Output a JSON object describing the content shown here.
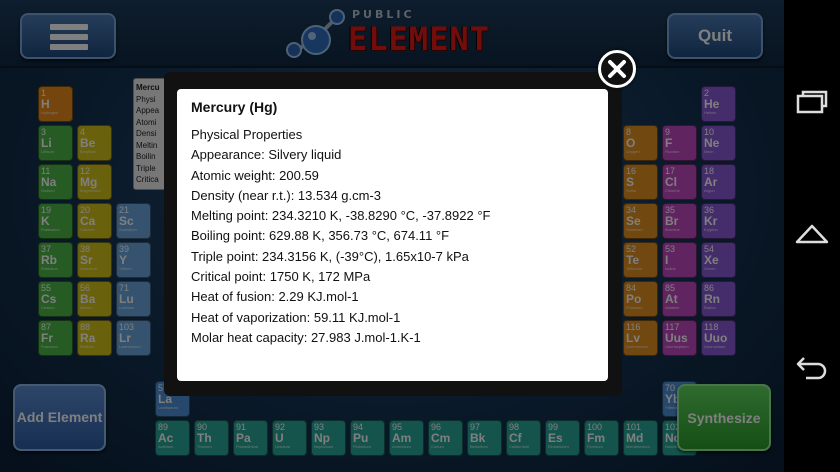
{
  "header": {
    "logo_small": "PUBLIC",
    "logo_big": "ELEMENT",
    "quit_label": "Quit"
  },
  "colors": {
    "alkali": "#4cb848",
    "alkaline": "#d4c21a",
    "transition": "#6aa6dc",
    "nonmetal": "#e09020",
    "halogen": "#c04ac0",
    "noble": "#8a5ad6",
    "lanthanide": "#4a90d9",
    "actinide": "#2aa89a",
    "hydrogen": "#e88a1a"
  },
  "elements": [
    {
      "n": "1",
      "s": "H",
      "name": "Hydrogen",
      "g": "hydrogen",
      "col": 0,
      "row": 0
    },
    {
      "n": "3",
      "s": "Li",
      "name": "Lithium",
      "g": "alkali",
      "col": 0,
      "row": 1
    },
    {
      "n": "4",
      "s": "Be",
      "name": "Beryllium",
      "g": "alkaline",
      "col": 1,
      "row": 1
    },
    {
      "n": "11",
      "s": "Na",
      "name": "Sodium",
      "g": "alkali",
      "col": 0,
      "row": 2
    },
    {
      "n": "12",
      "s": "Mg",
      "name": "Magnesium",
      "g": "alkaline",
      "col": 1,
      "row": 2
    },
    {
      "n": "19",
      "s": "K",
      "name": "Potassium",
      "g": "alkali",
      "col": 0,
      "row": 3
    },
    {
      "n": "20",
      "s": "Ca",
      "name": "Calcium",
      "g": "alkaline",
      "col": 1,
      "row": 3
    },
    {
      "n": "21",
      "s": "Sc",
      "name": "Scandium",
      "g": "transition",
      "col": 2,
      "row": 3
    },
    {
      "n": "37",
      "s": "Rb",
      "name": "Rubidium",
      "g": "alkali",
      "col": 0,
      "row": 4
    },
    {
      "n": "38",
      "s": "Sr",
      "name": "Strontium",
      "g": "alkaline",
      "col": 1,
      "row": 4
    },
    {
      "n": "39",
      "s": "Y",
      "name": "Yttrium",
      "g": "transition",
      "col": 2,
      "row": 4
    },
    {
      "n": "55",
      "s": "Cs",
      "name": "Cesium",
      "g": "alkali",
      "col": 0,
      "row": 5
    },
    {
      "n": "56",
      "s": "Ba",
      "name": "Barium",
      "g": "alkaline",
      "col": 1,
      "row": 5
    },
    {
      "n": "71",
      "s": "Lu",
      "name": "Lutetium",
      "g": "transition",
      "col": 2,
      "row": 5
    },
    {
      "n": "87",
      "s": "Fr",
      "name": "Francium",
      "g": "alkali",
      "col": 0,
      "row": 6
    },
    {
      "n": "88",
      "s": "Ra",
      "name": "Radium",
      "g": "alkaline",
      "col": 1,
      "row": 6
    },
    {
      "n": "103",
      "s": "Lr",
      "name": "Lawrencium",
      "g": "transition",
      "col": 2,
      "row": 6
    },
    {
      "n": "2",
      "s": "He",
      "name": "Helium",
      "g": "noble",
      "col": 17,
      "row": 0
    },
    {
      "n": "8",
      "s": "O",
      "name": "Oxygen",
      "g": "nonmetal",
      "col": 15,
      "row": 1
    },
    {
      "n": "9",
      "s": "F",
      "name": "Fluorine",
      "g": "halogen",
      "col": 16,
      "row": 1
    },
    {
      "n": "10",
      "s": "Ne",
      "name": "Neon",
      "g": "noble",
      "col": 17,
      "row": 1
    },
    {
      "n": "16",
      "s": "S",
      "name": "Sulfur",
      "g": "nonmetal",
      "col": 15,
      "row": 2
    },
    {
      "n": "17",
      "s": "Cl",
      "name": "Chlorine",
      "g": "halogen",
      "col": 16,
      "row": 2
    },
    {
      "n": "18",
      "s": "Ar",
      "name": "Argon",
      "g": "noble",
      "col": 17,
      "row": 2
    },
    {
      "n": "34",
      "s": "Se",
      "name": "Selenium",
      "g": "nonmetal",
      "col": 15,
      "row": 3
    },
    {
      "n": "35",
      "s": "Br",
      "name": "Bromine",
      "g": "halogen",
      "col": 16,
      "row": 3
    },
    {
      "n": "36",
      "s": "Kr",
      "name": "Krypton",
      "g": "noble",
      "col": 17,
      "row": 3
    },
    {
      "n": "52",
      "s": "Te",
      "name": "Tellurium",
      "g": "nonmetal",
      "col": 15,
      "row": 4
    },
    {
      "n": "53",
      "s": "I",
      "name": "Iodine",
      "g": "halogen",
      "col": 16,
      "row": 4
    },
    {
      "n": "54",
      "s": "Xe",
      "name": "Xenon",
      "g": "noble",
      "col": 17,
      "row": 4
    },
    {
      "n": "84",
      "s": "Po",
      "name": "Polonium",
      "g": "nonmetal",
      "col": 15,
      "row": 5
    },
    {
      "n": "85",
      "s": "At",
      "name": "Astatine",
      "g": "halogen",
      "col": 16,
      "row": 5
    },
    {
      "n": "86",
      "s": "Rn",
      "name": "Radon",
      "g": "noble",
      "col": 17,
      "row": 5
    },
    {
      "n": "116",
      "s": "Lv",
      "name": "Livermorium",
      "g": "nonmetal",
      "col": 15,
      "row": 6
    },
    {
      "n": "117",
      "s": "Uus",
      "name": "Ununseptium",
      "g": "halogen",
      "col": 16,
      "row": 6
    },
    {
      "n": "118",
      "s": "Uuo",
      "name": "Ununoctium",
      "g": "noble",
      "col": 17,
      "row": 6
    },
    {
      "n": "57",
      "s": "La",
      "name": "Lanthanum",
      "g": "lanthanide",
      "col": 3,
      "row": 8
    },
    {
      "n": "70",
      "s": "Yb",
      "name": "Ytterbium",
      "g": "lanthanide",
      "col": 16,
      "row": 8
    },
    {
      "n": "89",
      "s": "Ac",
      "name": "Actinium",
      "g": "actinide",
      "col": 3,
      "row": 9
    },
    {
      "n": "90",
      "s": "Th",
      "name": "Thorium",
      "g": "actinide",
      "col": 4,
      "row": 9
    },
    {
      "n": "91",
      "s": "Pa",
      "name": "Protactinium",
      "g": "actinide",
      "col": 5,
      "row": 9
    },
    {
      "n": "92",
      "s": "U",
      "name": "Uranium",
      "g": "actinide",
      "col": 6,
      "row": 9
    },
    {
      "n": "93",
      "s": "Np",
      "name": "Neptunium",
      "g": "actinide",
      "col": 7,
      "row": 9
    },
    {
      "n": "94",
      "s": "Pu",
      "name": "Plutonium",
      "g": "actinide",
      "col": 8,
      "row": 9
    },
    {
      "n": "95",
      "s": "Am",
      "name": "Americium",
      "g": "actinide",
      "col": 9,
      "row": 9
    },
    {
      "n": "96",
      "s": "Cm",
      "name": "Curium",
      "g": "actinide",
      "col": 10,
      "row": 9
    },
    {
      "n": "97",
      "s": "Bk",
      "name": "Berkelium",
      "g": "actinide",
      "col": 11,
      "row": 9
    },
    {
      "n": "98",
      "s": "Cf",
      "name": "Californium",
      "g": "actinide",
      "col": 12,
      "row": 9
    },
    {
      "n": "99",
      "s": "Es",
      "name": "Einsteinium",
      "g": "actinide",
      "col": 13,
      "row": 9
    },
    {
      "n": "100",
      "s": "Fm",
      "name": "Fermium",
      "g": "actinide",
      "col": 14,
      "row": 9
    },
    {
      "n": "101",
      "s": "Md",
      "name": "Mendelevium",
      "g": "actinide",
      "col": 15,
      "row": 9
    },
    {
      "n": "102",
      "s": "No",
      "name": "Nobelium",
      "g": "actinide",
      "col": 16,
      "row": 9
    }
  ],
  "preview_panel": [
    "Mercu",
    "Physi",
    "Appea",
    "Atomi",
    "Densi",
    "Meltin",
    "Boilin",
    "Triple",
    "Critica"
  ],
  "buttons": {
    "add_element": "Add Element",
    "synthesize": "Synthesize"
  },
  "dialog": {
    "title": "Mercury  (Hg)",
    "lines": [
      "Physical Properties",
      "Appearance: Silvery liquid",
      "Atomic weight: 200.59",
      "Density (near r.t.): 13.534 g.cm-3",
      "Melting point: 234.3210 K, -38.8290 °C, -37.8922 °F",
      "Boiling point: 629.88 K, 356.73 °C, 674.11 °F",
      "Triple point: 234.3156 K, (-39°C), 1.65x10-7 kPa",
      "Critical point: 1750 K, 172 MPa",
      "Heat of fusion: 2.29 KJ.mol-1",
      "Heat of vaporization: 59.11 KJ.mol-1",
      "Molar heat capacity: 27.983 J.mol-1.K-1"
    ]
  },
  "icons": {
    "menu": "hamburger-icon",
    "close": "close-icon",
    "recents": "recents-icon",
    "home": "home-icon",
    "back": "back-icon"
  }
}
